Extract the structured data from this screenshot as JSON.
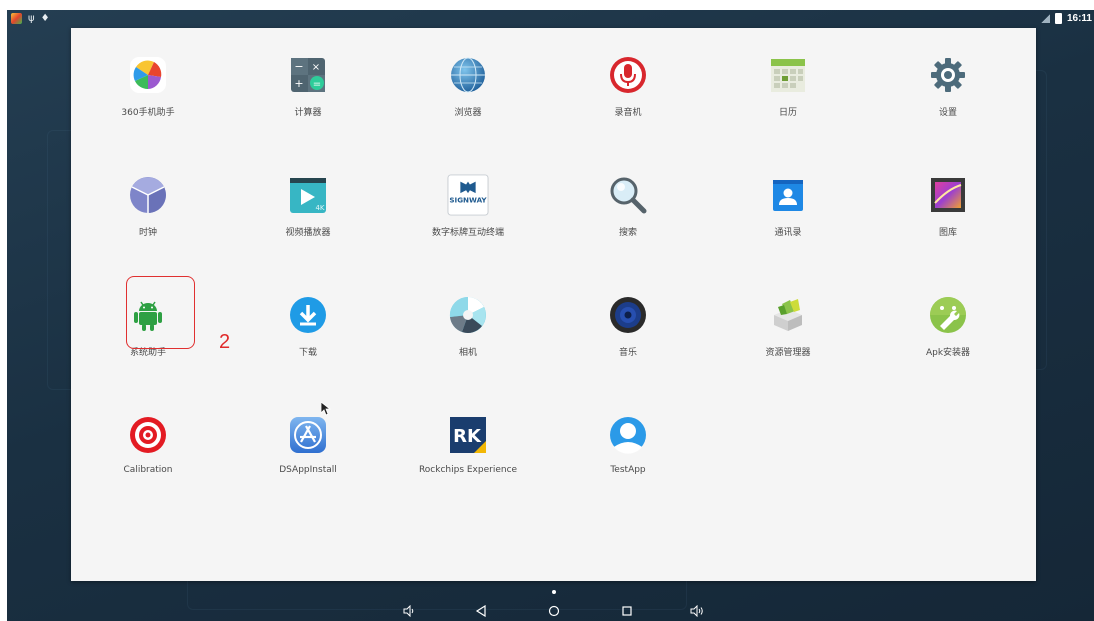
{
  "status_bar": {
    "left_icons": [
      "app-notification-icon",
      "usb-icon",
      "debug-icon"
    ],
    "time": "16:11"
  },
  "apps": [
    {
      "label": "360手机助手",
      "icon": "360-assistant-icon"
    },
    {
      "label": "计算器",
      "icon": "calculator-icon"
    },
    {
      "label": "浏览器",
      "icon": "browser-globe-icon"
    },
    {
      "label": "录音机",
      "icon": "microphone-icon"
    },
    {
      "label": "日历",
      "icon": "calendar-icon"
    },
    {
      "label": "设置",
      "icon": "gear-icon"
    },
    {
      "label": "时钟",
      "icon": "clock-icon"
    },
    {
      "label": "视频播放器",
      "icon": "video-player-icon"
    },
    {
      "label": "数字标牌互动终端",
      "icon": "signway-icon",
      "icon_text": "SIGNWAY"
    },
    {
      "label": "搜索",
      "icon": "search-icon"
    },
    {
      "label": "通讯录",
      "icon": "contacts-icon"
    },
    {
      "label": "图库",
      "icon": "gallery-icon"
    },
    {
      "label": "系统助手",
      "icon": "android-icon"
    },
    {
      "label": "下载",
      "icon": "download-icon"
    },
    {
      "label": "相机",
      "icon": "camera-icon"
    },
    {
      "label": "音乐",
      "icon": "music-speaker-icon"
    },
    {
      "label": "资源管理器",
      "icon": "file-manager-icon"
    },
    {
      "label": "Apk安装器",
      "icon": "apk-installer-icon"
    },
    {
      "label": "Calibration",
      "icon": "calibration-target-icon"
    },
    {
      "label": "DSAppInstall",
      "icon": "app-store-icon"
    },
    {
      "label": "Rockchips Experience",
      "icon": "rk-icon",
      "icon_text": "RK"
    },
    {
      "label": "TestApp",
      "icon": "test-app-icon"
    }
  ],
  "annotation": {
    "step_number": "2",
    "highlight_color": "#e03030"
  },
  "nav_bar": {
    "buttons": [
      "volume-down-icon",
      "back-icon",
      "home-icon",
      "recents-icon",
      "volume-up-icon"
    ]
  },
  "colors": {
    "wallpaper": "#1d3447",
    "drawer_background": "#f5f5f5",
    "label_text": "#4a4a4a"
  }
}
